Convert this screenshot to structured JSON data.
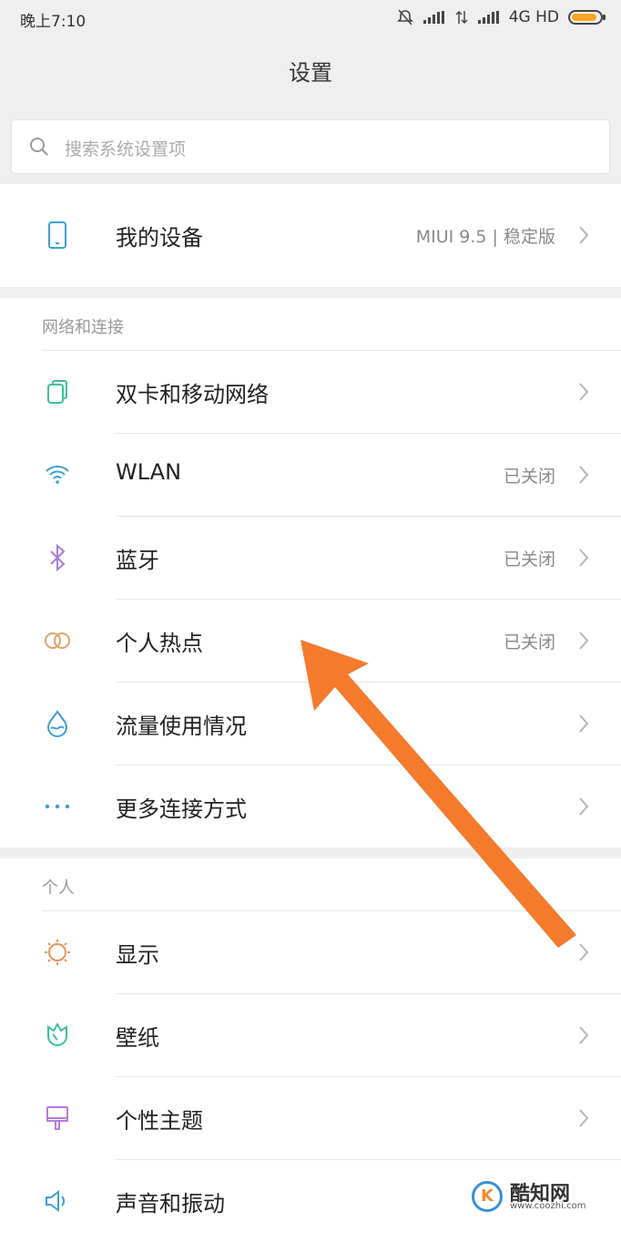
{
  "status": {
    "time": "晚上7:10",
    "network": "4G HD"
  },
  "header": {
    "title": "设置"
  },
  "search": {
    "placeholder": "搜索系统设置项"
  },
  "device": {
    "label": "我的设备",
    "value": "MIUI 9.5 | 稳定版"
  },
  "network_section": {
    "title": "网络和连接",
    "items": [
      {
        "label": "双卡和移动网络",
        "value": "",
        "icon": "dual-sim-icon"
      },
      {
        "label": "WLAN",
        "value": "已关闭",
        "icon": "wifi-icon"
      },
      {
        "label": "蓝牙",
        "value": "已关闭",
        "icon": "bluetooth-icon"
      },
      {
        "label": "个人热点",
        "value": "已关闭",
        "icon": "hotspot-icon"
      },
      {
        "label": "流量使用情况",
        "value": "",
        "icon": "data-usage-icon"
      },
      {
        "label": "更多连接方式",
        "value": "",
        "icon": "more-dots-icon"
      }
    ]
  },
  "personal_section": {
    "title": "个人",
    "items": [
      {
        "label": "显示",
        "icon": "display-icon"
      },
      {
        "label": "壁纸",
        "icon": "wallpaper-icon"
      },
      {
        "label": "个性主题",
        "icon": "theme-icon"
      },
      {
        "label": "声音和振动",
        "icon": "sound-icon"
      }
    ]
  },
  "watermark": {
    "name": "酷知网",
    "url": "www.coozhi.com",
    "logo": "K"
  },
  "colors": {
    "accent_arrow": "#f47a2c",
    "battery": "#f5a623"
  }
}
